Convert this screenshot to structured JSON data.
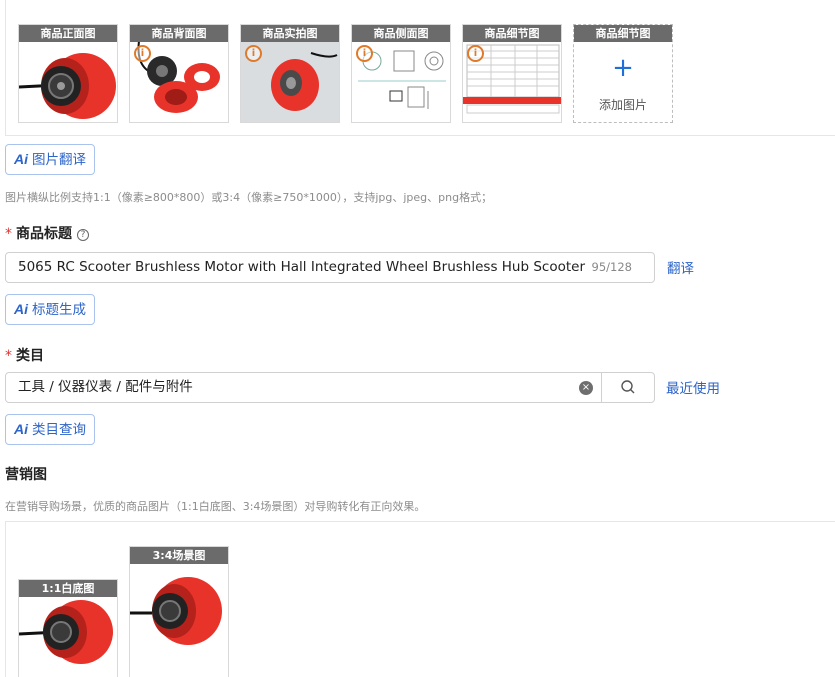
{
  "gallery": {
    "tiles": [
      {
        "tag": "商品正面图"
      },
      {
        "tag": "商品背面图"
      },
      {
        "tag": "商品实拍图"
      },
      {
        "tag": "商品侧面图"
      },
      {
        "tag": "商品细节图"
      }
    ],
    "add_tile": {
      "tag": "商品细节图",
      "plus": "+",
      "label": "添加图片"
    },
    "info_glyph": "i"
  },
  "image_translate": {
    "ai": "Ai",
    "label": "图片翻译"
  },
  "image_hint": "图片横纵比例支持1:1（像素≥800*800）或3:4（像素≥750*1000），支持jpg、jpeg、png格式；",
  "title_field": {
    "required_mark": "*",
    "label": "商品标题",
    "help_glyph": "?",
    "value": "5065 RC Scooter Brushless Motor with Hall Integrated Wheel Brushless Hub Scooter Motor",
    "counter": "95/128",
    "translate_link": "翻译"
  },
  "title_generate": {
    "ai": "Ai",
    "label": "标题生成"
  },
  "category_field": {
    "required_mark": "*",
    "label": "类目",
    "value": "工具 / 仪器仪表 / 配件与附件",
    "recent_link": "最近使用",
    "clear_glyph": "×"
  },
  "category_query": {
    "ai": "Ai",
    "label": "类目查询"
  },
  "marketing": {
    "label": "营销图",
    "hint": "在营销导购场景，优质的商品图片（1:1白底图、3:4场景图）对导购转化有正向效果。",
    "tiles": [
      {
        "tag": "1:1白底图"
      },
      {
        "tag": "3:4场景图"
      }
    ]
  },
  "colors": {
    "accent": "#2d65c9",
    "required": "#e03131",
    "motor_red": "#e8332a",
    "badge": "#e07a2a"
  }
}
